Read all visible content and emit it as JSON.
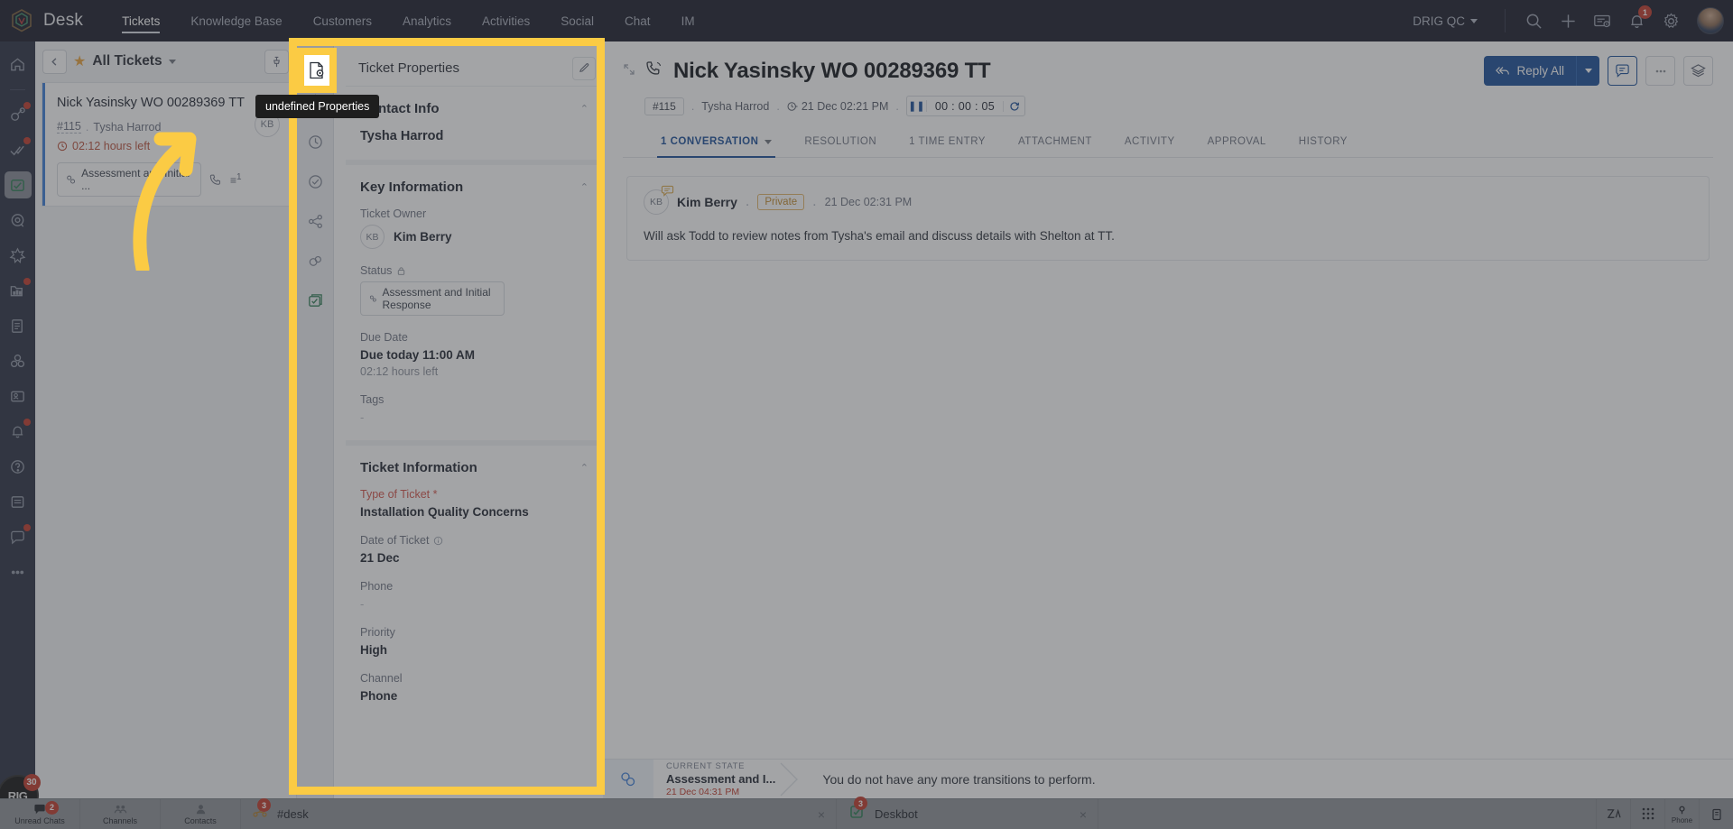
{
  "topnav": {
    "brand": "Desk",
    "items": [
      {
        "label": "Tickets",
        "active": true
      },
      {
        "label": "Knowledge Base",
        "active": false
      },
      {
        "label": "Customers",
        "active": false
      },
      {
        "label": "Analytics",
        "active": false
      },
      {
        "label": "Activities",
        "active": false
      },
      {
        "label": "Social",
        "active": false
      },
      {
        "label": "Chat",
        "active": false
      },
      {
        "label": "IM",
        "active": false
      }
    ],
    "org": "DRIG QC",
    "icons": [
      "search-icon",
      "add-icon",
      "card-info-icon",
      "notification-bell-icon",
      "gear-icon"
    ],
    "notification_count": "1"
  },
  "ticket_list": {
    "view_title": "All Tickets",
    "star_icon": "star-icon",
    "back_icon": "chevron-left-icon",
    "pin_icon": "pin-icon",
    "card": {
      "title": "Nick Yasinsky WO 00289369 TT",
      "id": "#115",
      "contact": "Tysha Harrod",
      "sla": "02:12 hours left",
      "status_chip": "Assessment and Initial ...",
      "avatar_initials": "KB",
      "thread_count": "1"
    }
  },
  "props_rail": {
    "icons": [
      "properties-icon",
      "insights-bulb-icon",
      "history-clock-icon",
      "tasks-check-icon",
      "share-icon",
      "attachment-link-icon",
      "notes-icon"
    ]
  },
  "tooltip": {
    "text": "undefined Properties"
  },
  "properties_panel": {
    "header": "Ticket Properties",
    "edit_icon": "edit-pencil-icon",
    "sections": [
      {
        "title": "Contact Info",
        "collapse_icon": "chevron-up-icon",
        "contact_name": "Tysha Harrod"
      },
      {
        "title": "Key Information",
        "collapse_icon": "chevron-up-icon",
        "fields": [
          {
            "label": "Ticket Owner",
            "value": "Kim Berry",
            "avatar": "KB",
            "type": "owner"
          },
          {
            "label": "Status",
            "value": "Assessment and Initial Response",
            "lock_icon": "lock-icon",
            "type": "chip"
          },
          {
            "label": "Due Date",
            "value": "Due today 11:00 AM",
            "sub": "02:12 hours left",
            "type": "text"
          },
          {
            "label": "Tags",
            "value": "-",
            "type": "empty"
          }
        ]
      },
      {
        "title": "Ticket Information",
        "collapse_icon": "chevron-up-icon",
        "fields": [
          {
            "label": "Type of Ticket *",
            "value": "Installation Quality Concerns",
            "required": true,
            "type": "text"
          },
          {
            "label": "Date of Ticket",
            "value": "21 Dec",
            "info_icon": "info-icon",
            "type": "text"
          },
          {
            "label": "Phone",
            "value": "-",
            "type": "empty"
          },
          {
            "label": "Priority",
            "value": "High",
            "type": "text"
          },
          {
            "label": "Channel",
            "value": "Phone",
            "type": "text"
          }
        ]
      }
    ]
  },
  "main": {
    "collapse_icon": "collapse-arrows-icon",
    "channel_icon": "phone-call-icon",
    "title": "Nick Yasinsky WO 00289369 TT",
    "meta": {
      "id": "#115",
      "contact": "Tysha Harrod",
      "created_icon": "clock-icon",
      "created": "21 Dec 02:21 PM",
      "timer": "00 : 00 : 05",
      "timer_pause_icon": "pause-icon",
      "timer_refresh_icon": "refresh-icon"
    },
    "actions": {
      "reply_all": "Reply All",
      "reply_icon": "reply-all-icon",
      "dropdown_icon": "chevron-down-icon",
      "comment_icon": "comment-icon",
      "more_icon": "more-dots-icon",
      "layers_icon": "layers-icon"
    },
    "tabs": [
      {
        "label": "1 CONVERSATION",
        "active": true,
        "has_caret": true
      },
      {
        "label": "RESOLUTION",
        "active": false,
        "has_caret": false
      },
      {
        "label": "1 TIME ENTRY",
        "active": false,
        "has_caret": false
      },
      {
        "label": "ATTACHMENT",
        "active": false,
        "has_caret": false
      },
      {
        "label": "ACTIVITY",
        "active": false,
        "has_caret": false
      },
      {
        "label": "APPROVAL",
        "active": false,
        "has_caret": false
      },
      {
        "label": "HISTORY",
        "active": false,
        "has_caret": false
      }
    ],
    "conversation": {
      "avatar_initials": "KB",
      "author": "Kim Berry",
      "visibility": "Private",
      "timestamp": "21 Dec 02:31 PM",
      "body": "Will ask Todd to review notes from Tysha's email and discuss details with Shelton at TT."
    },
    "state_bar": {
      "icon": "state-flow-icon",
      "label": "CURRENT STATE",
      "value": "Assessment and I...",
      "date": "21 Dec 04:31 PM",
      "message": "You do not have any more transitions to perform."
    }
  },
  "left_rail": {
    "icons": [
      {
        "name": "home-icon",
        "badge": false,
        "selected": false
      },
      {
        "name": "link-chain-icon",
        "badge": true,
        "selected": false
      },
      {
        "name": "double-check-icon",
        "badge": true,
        "selected": false
      },
      {
        "name": "desk-ticket-icon",
        "badge": false,
        "selected": true
      },
      {
        "name": "at-mention-icon",
        "badge": false,
        "selected": false
      },
      {
        "name": "puzzle-icon",
        "badge": false,
        "selected": false
      },
      {
        "name": "reports-chart-icon",
        "badge": true,
        "selected": false
      },
      {
        "name": "documents-icon",
        "badge": false,
        "selected": false
      },
      {
        "name": "projects-icon",
        "badge": false,
        "selected": false
      },
      {
        "name": "contacts-card-icon",
        "badge": false,
        "selected": false
      },
      {
        "name": "bell-alert-icon",
        "badge": true,
        "selected": false
      },
      {
        "name": "help-icon",
        "badge": false,
        "selected": false
      },
      {
        "name": "list-icon",
        "badge": false,
        "selected": false
      },
      {
        "name": "chat-icon",
        "badge": true,
        "selected": false
      },
      {
        "name": "more-dots-icon",
        "badge": false,
        "selected": false
      }
    ],
    "badge_brand": "RIG",
    "badge_count": "30"
  },
  "taskbar": {
    "items": [
      {
        "label": "Unread Chats",
        "icon": "unread-chats-icon",
        "badge": "2"
      },
      {
        "label": "Channels",
        "icon": "channels-icon",
        "badge": ""
      },
      {
        "label": "Contacts",
        "icon": "contacts-icon",
        "badge": ""
      }
    ],
    "windows": [
      {
        "label": "#desk",
        "icon": "desk-window-icon",
        "badge": "3",
        "close": "×"
      },
      {
        "label": "Deskbot",
        "icon": "deskbot-icon",
        "badge": "3",
        "close": "×"
      }
    ],
    "right_icons": [
      {
        "name": "zia-icon",
        "label": ""
      },
      {
        "name": "dialpad-icon",
        "label": ""
      },
      {
        "name": "phone-icon",
        "label": "Phone"
      },
      {
        "name": "clipboard-icon",
        "label": ""
      }
    ]
  },
  "colors": {
    "accent_blue": "#1a4f99",
    "highlight_yellow": "#fbcb44",
    "nav_dark": "#191c2b",
    "danger": "#c0392b"
  }
}
